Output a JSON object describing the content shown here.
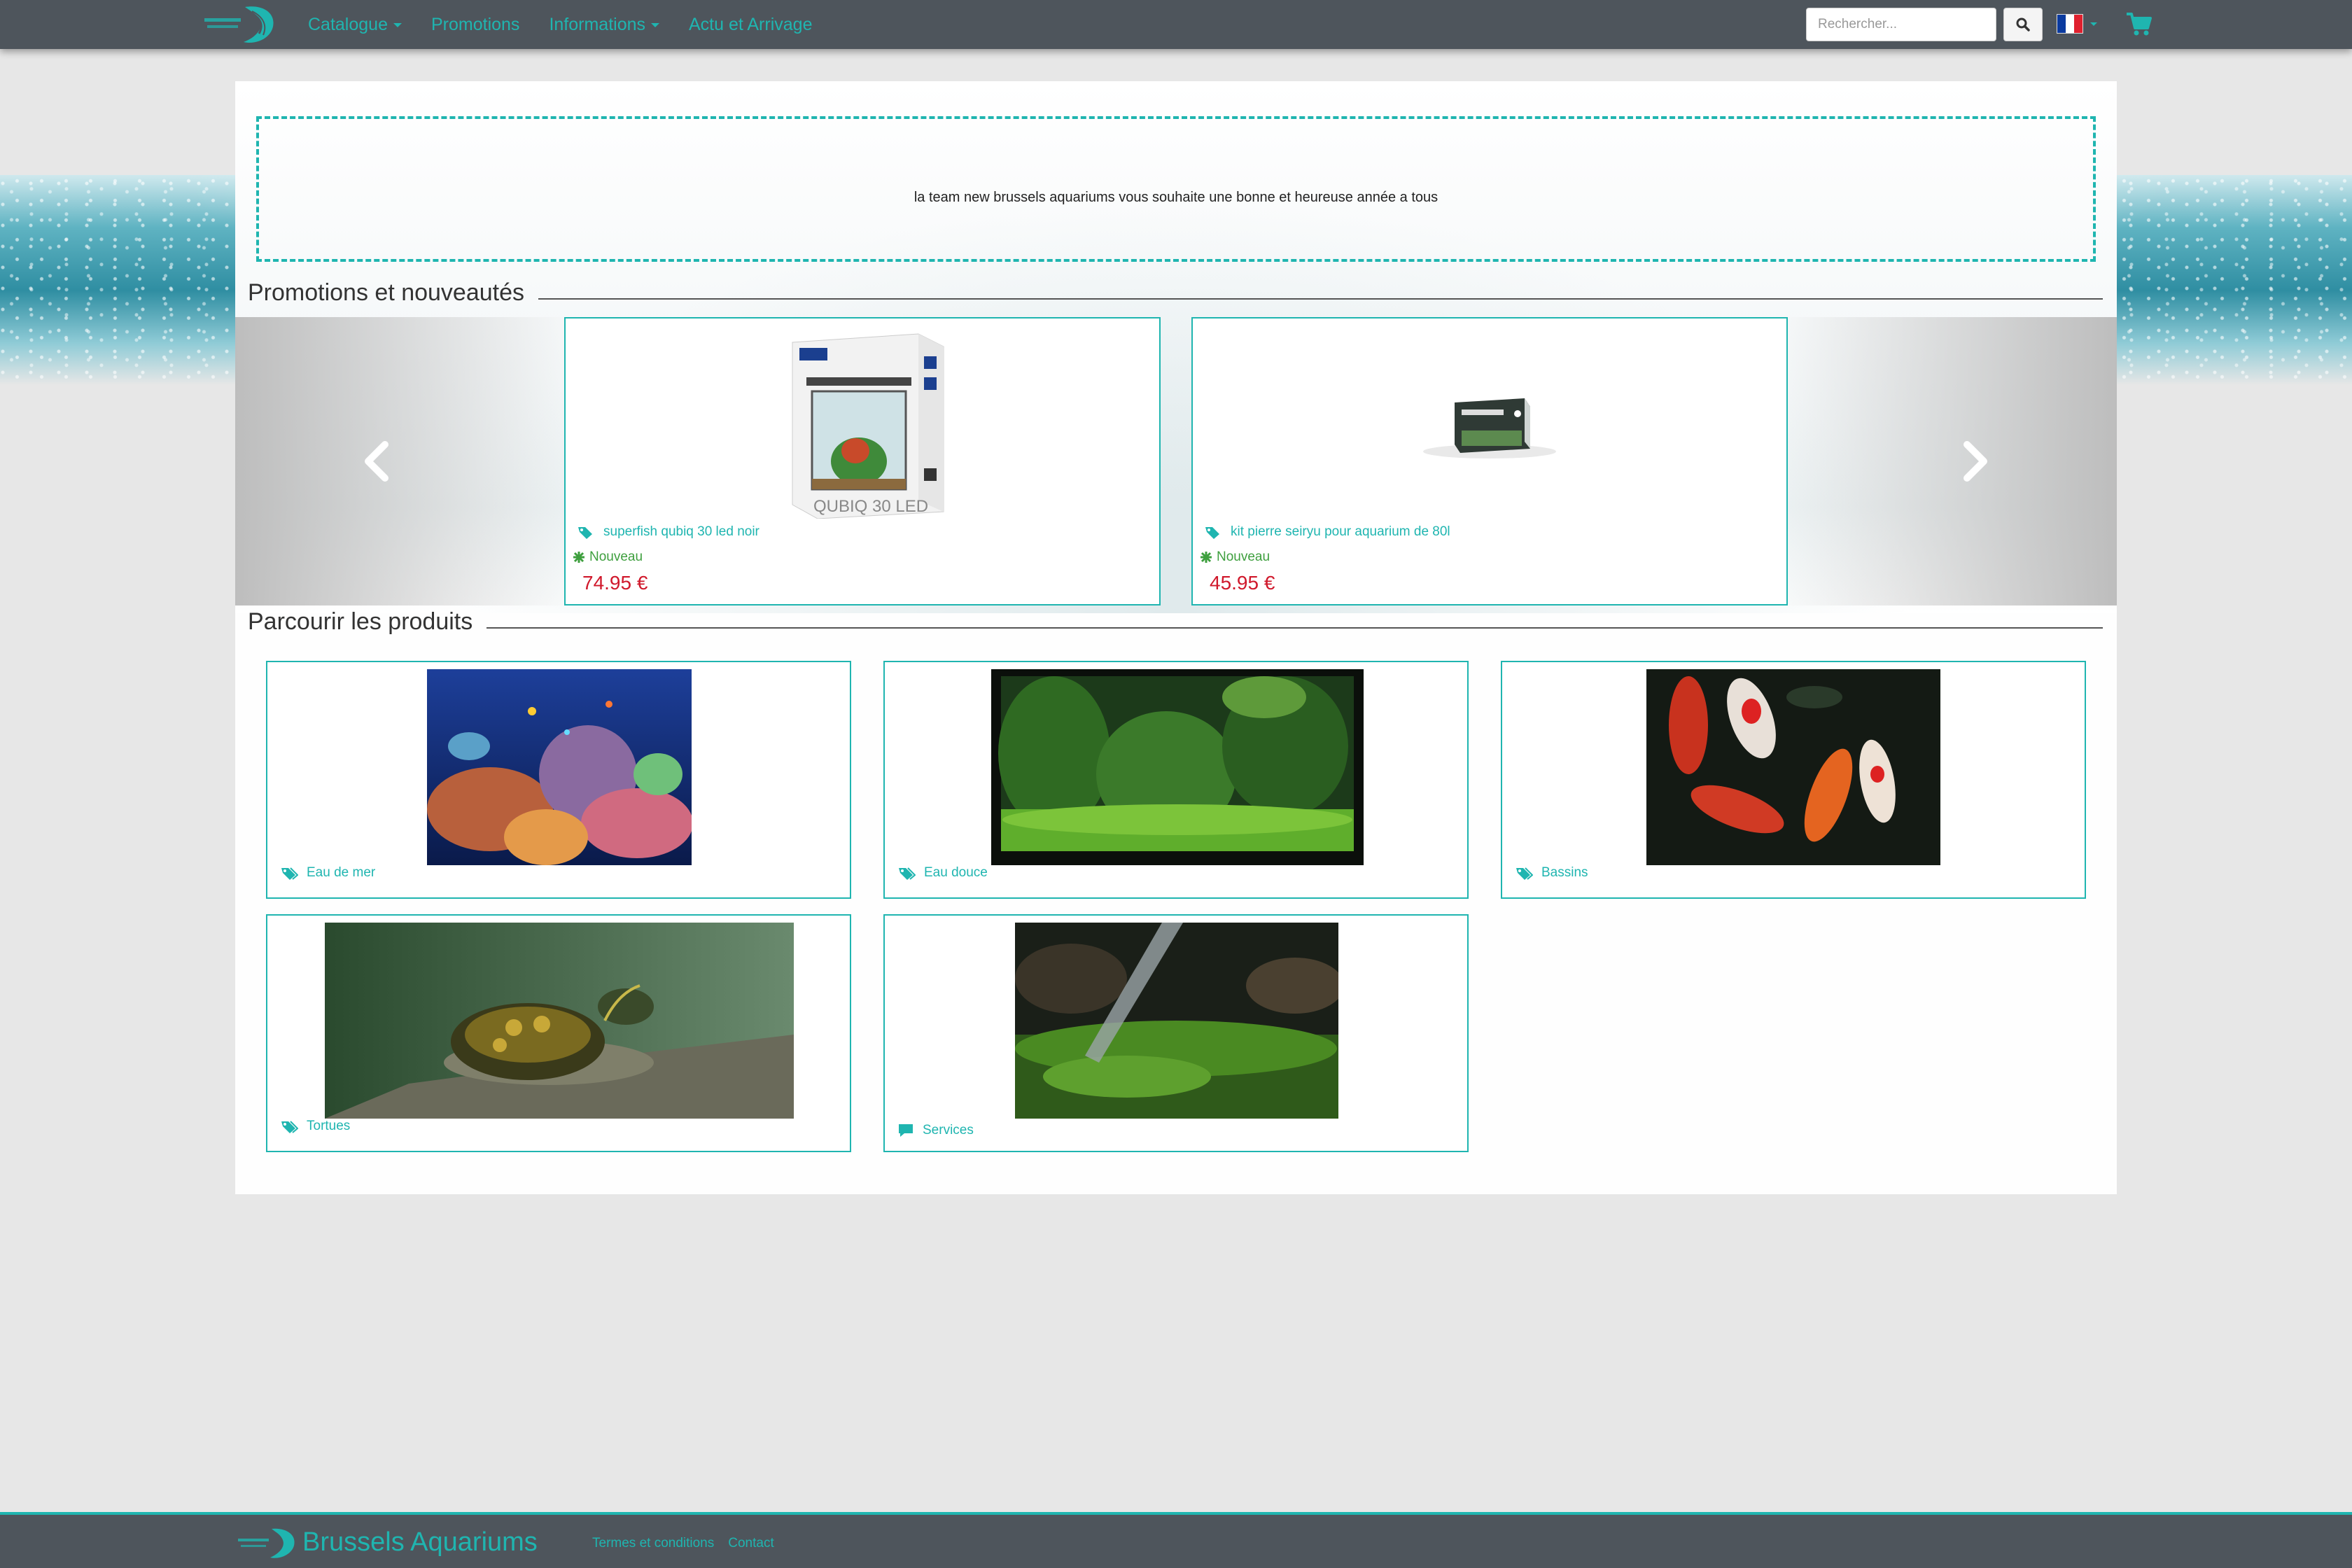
{
  "colors": {
    "accent": "#1fb5b0",
    "navbar": "#4e555c",
    "price": "#d0182b",
    "badge": "#3e9f3e",
    "page_bg": "#e7e7e7"
  },
  "navbar": {
    "menu": [
      {
        "label": "Catalogue",
        "has_dropdown": true
      },
      {
        "label": "Promotions",
        "has_dropdown": false
      },
      {
        "label": "Informations",
        "has_dropdown": true
      },
      {
        "label": "Actu et Arrivage",
        "has_dropdown": false
      }
    ],
    "search": {
      "placeholder": "Rechercher...",
      "value": ""
    },
    "search_icon": "search-icon",
    "language_icon": "flag-fr-icon",
    "cart_icon": "shopping-cart-icon"
  },
  "announcement": {
    "text": "la team new brussels aquariums vous souhaite une bonne et heureuse année a tous"
  },
  "promotions": {
    "title": "Promotions et nouveautés",
    "items": [
      {
        "name": "superfish qubiq 30 led noir",
        "badge": "Nouveau",
        "price": "74.95 €"
      },
      {
        "name": "kit pierre seiryu pour aquarium de 80l",
        "badge": "Nouveau",
        "price": "45.95 €"
      }
    ],
    "prev_icon": "chevron-left-icon",
    "next_icon": "chevron-right-icon"
  },
  "browse": {
    "title": "Parcourir les produits",
    "categories": [
      {
        "label": "Eau de mer",
        "icon": "tags-icon"
      },
      {
        "label": "Eau douce",
        "icon": "tags-icon"
      },
      {
        "label": "Bassins",
        "icon": "tags-icon"
      },
      {
        "label": "Tortues",
        "icon": "tags-icon"
      },
      {
        "label": "Services",
        "icon": "comment-icon"
      }
    ]
  },
  "footer": {
    "brand": "Brussels Aquariums",
    "links": [
      {
        "label": "Termes et conditions"
      },
      {
        "label": "Contact"
      }
    ]
  }
}
